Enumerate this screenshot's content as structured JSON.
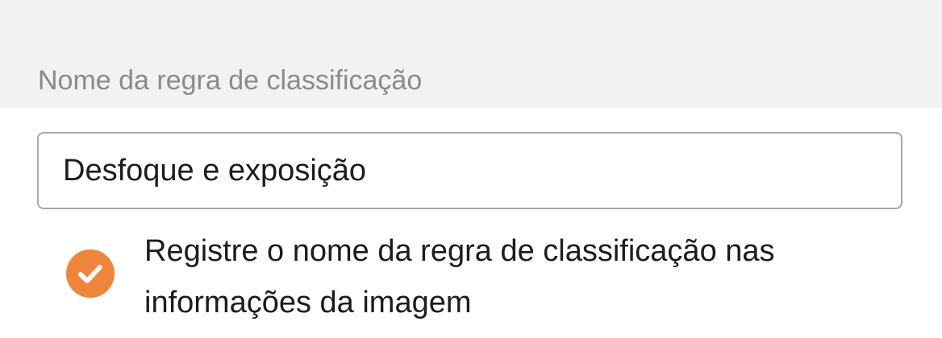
{
  "section": {
    "title": "Nome da regra de classificação"
  },
  "rule_name_field": {
    "value": "Desfoque e exposição",
    "placeholder": ""
  },
  "record_option": {
    "checked": true,
    "icon": "checkmark-circle-icon",
    "label": "Registre o nome da regra de classificação nas informações da imagem"
  },
  "colors": {
    "accent": "#f0843a",
    "header_bg": "#f2f2f2",
    "section_title": "#8a8a8e",
    "text": "#1c1c1e",
    "field_border": "#a8a8ad"
  }
}
